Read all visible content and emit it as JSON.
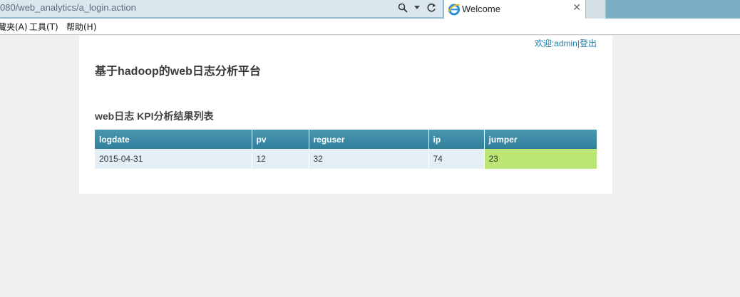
{
  "browser": {
    "address": "080/web_analytics/a_login.action",
    "tab_title": "Welcome",
    "menu": [
      "藏夹(A)",
      "工具(T)",
      "帮助(H)"
    ]
  },
  "header": {
    "welcome_prefix": "欢迎:",
    "username": "admin",
    "separator": "|",
    "logout": "登出"
  },
  "app_title": "基于hadoop的web日志分析平台",
  "section_title": "web日志 KPI分析结果列表",
  "table": {
    "columns": [
      "logdate",
      "pv",
      "reguser",
      "ip",
      "jumper"
    ],
    "rows": [
      [
        "2015-04-31",
        "12",
        "32",
        "74",
        "23"
      ]
    ]
  },
  "colors": {
    "header_bg": "#3287a2",
    "row_bg": "#e3eff5",
    "highlight_cell": "#bbe676",
    "link": "#1f7fa8"
  },
  "icons": [
    "search-icon",
    "dropdown-icon",
    "refresh-icon",
    "ie-icon",
    "close-icon"
  ]
}
